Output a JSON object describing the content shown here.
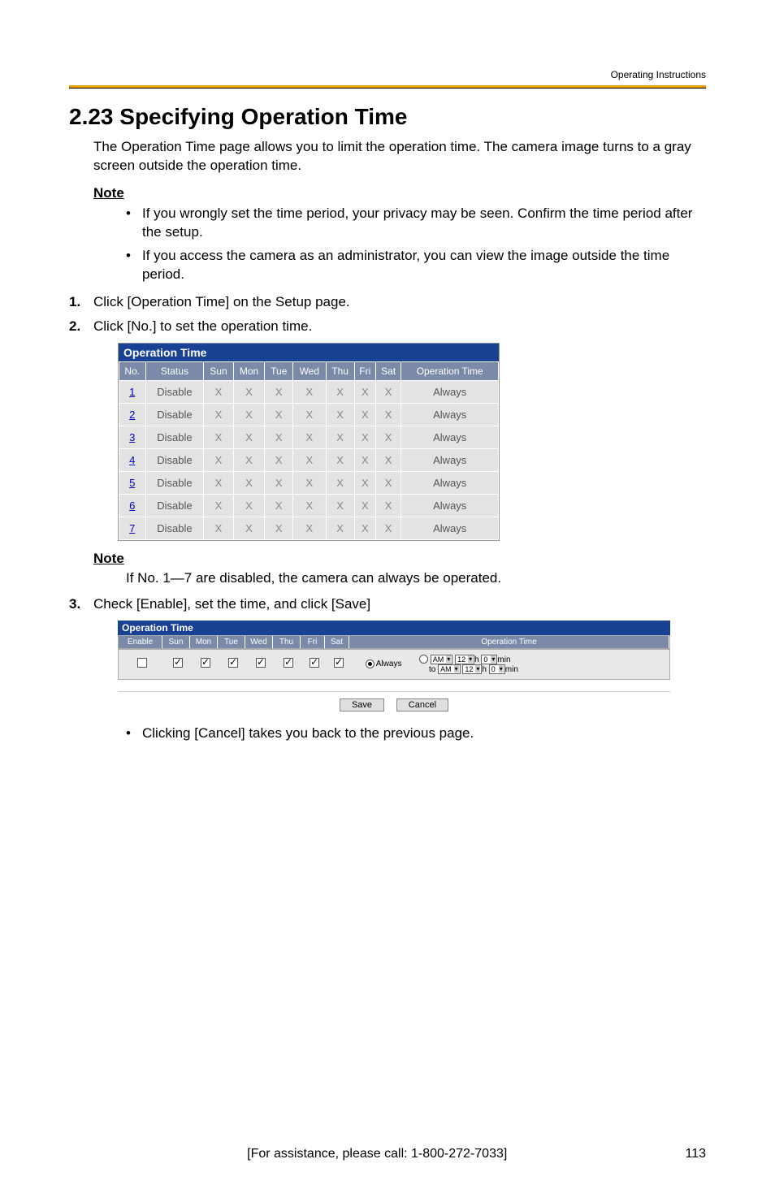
{
  "header": {
    "right_label": "Operating Instructions"
  },
  "title": "2.23  Specifying Operation Time",
  "intro": "The Operation Time page allows you to limit the operation time. The camera image turns to a gray screen outside the operation time.",
  "note1": {
    "heading": "Note",
    "items": [
      "If you wrongly set the time period, your privacy may be seen. Confirm the time period after the setup.",
      "If you access the camera as an administrator, you can view the image outside the time period."
    ]
  },
  "steps": {
    "s1": {
      "num": "1.",
      "text": "Click [Operation Time] on the Setup page."
    },
    "s2": {
      "num": "2.",
      "text": "Click [No.] to set the operation time."
    },
    "s3": {
      "num": "3.",
      "text": "Check [Enable], set the time, and click [Save]"
    }
  },
  "fig1": {
    "title": "Operation Time",
    "cols": [
      "No.",
      "Status",
      "Sun",
      "Mon",
      "Tue",
      "Wed",
      "Thu",
      "Fri",
      "Sat",
      "Operation Time"
    ],
    "rows": [
      {
        "no": "1",
        "status": "Disable",
        "days": [
          "X",
          "X",
          "X",
          "X",
          "X",
          "X",
          "X"
        ],
        "op": "Always"
      },
      {
        "no": "2",
        "status": "Disable",
        "days": [
          "X",
          "X",
          "X",
          "X",
          "X",
          "X",
          "X"
        ],
        "op": "Always"
      },
      {
        "no": "3",
        "status": "Disable",
        "days": [
          "X",
          "X",
          "X",
          "X",
          "X",
          "X",
          "X"
        ],
        "op": "Always"
      },
      {
        "no": "4",
        "status": "Disable",
        "days": [
          "X",
          "X",
          "X",
          "X",
          "X",
          "X",
          "X"
        ],
        "op": "Always"
      },
      {
        "no": "5",
        "status": "Disable",
        "days": [
          "X",
          "X",
          "X",
          "X",
          "X",
          "X",
          "X"
        ],
        "op": "Always"
      },
      {
        "no": "6",
        "status": "Disable",
        "days": [
          "X",
          "X",
          "X",
          "X",
          "X",
          "X",
          "X"
        ],
        "op": "Always"
      },
      {
        "no": "7",
        "status": "Disable",
        "days": [
          "X",
          "X",
          "X",
          "X",
          "X",
          "X",
          "X"
        ],
        "op": "Always"
      }
    ]
  },
  "note2": {
    "heading": "Note",
    "text": "If No. 1—7 are disabled, the camera can always be operated."
  },
  "fig2": {
    "title": "Operation Time",
    "head": [
      "Enable",
      "Sun",
      "Mon",
      "Tue",
      "Wed",
      "Thu",
      "Fri",
      "Sat",
      "Operation Time"
    ],
    "enable_checked": false,
    "days_checked": [
      true,
      true,
      true,
      true,
      true,
      true,
      true
    ],
    "always_label": "Always",
    "always_selected": true,
    "from": {
      "ampm": "AM",
      "h": "12",
      "m": "0"
    },
    "to": {
      "ampm": "AM",
      "h": "12",
      "m": "0"
    },
    "h_label": "h",
    "min_label": "min",
    "to_label": "to",
    "save": "Save",
    "cancel": "Cancel"
  },
  "post_bullet": "Clicking [Cancel] takes you back to the previous page.",
  "footer": {
    "center": "[For assistance, please call: 1-800-272-7033]",
    "page": "113"
  }
}
